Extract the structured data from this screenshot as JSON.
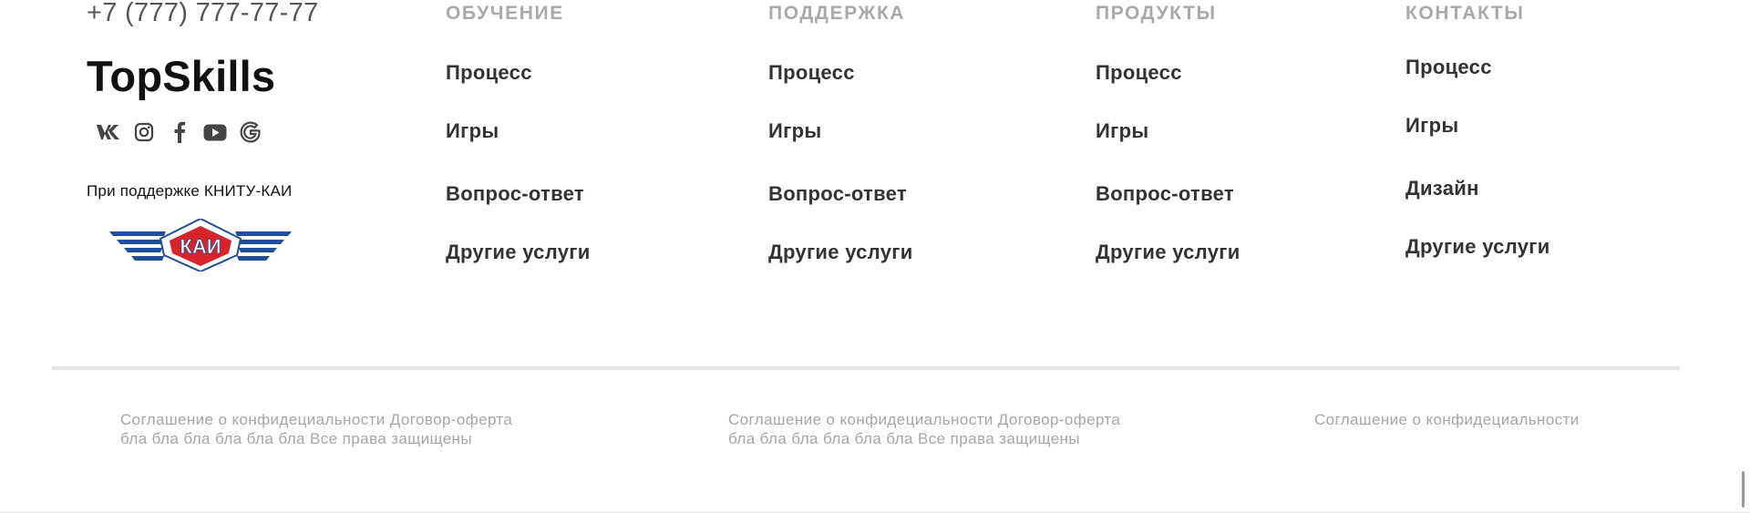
{
  "contact": {
    "phone": "+7 (777) 777-77-77"
  },
  "brand": {
    "name": "TopSkills"
  },
  "socials": [
    {
      "icon": "vk-icon"
    },
    {
      "icon": "instagram-icon"
    },
    {
      "icon": "facebook-icon"
    },
    {
      "icon": "youtube-icon"
    },
    {
      "icon": "google-icon"
    }
  ],
  "support": {
    "text": "При поддержке КНИТУ-КАИ",
    "logo_text": "КАИ"
  },
  "nav": {
    "columns": [
      {
        "heading": "ОБУЧЕНИЕ",
        "links": [
          "Процесс",
          "Игры",
          "Вопрос-ответ",
          "Другие услуги"
        ]
      },
      {
        "heading": "ПОДДЕРЖКА",
        "links": [
          "Процесс",
          "Игры",
          "Вопрос-ответ",
          "Другие услуги"
        ]
      },
      {
        "heading": "ПРОДУКТЫ",
        "links": [
          "Процесс",
          "Игры",
          "Вопрос-ответ",
          "Другие услуги"
        ]
      },
      {
        "heading": "КОНТАКТЫ",
        "links": [
          "Процесс",
          "Игры",
          "Дизайн",
          "Другие услуги"
        ]
      }
    ]
  },
  "legal": [
    {
      "line1": "Соглашение о конфидециальности Договор-оферта",
      "line2": "бла бла бла бла бла бла Все права защищены"
    },
    {
      "line1": "Соглашение о конфидециальности Договор-оферта",
      "line2": "бла бла бла бла бла бла Все права защищены"
    },
    {
      "line1": "Соглашение о конфидециальности"
    }
  ],
  "colors": {
    "heading": "#a9a9a9",
    "link": "#333333",
    "legal": "#a6a6a6",
    "kai_blue": "#1f4e9c",
    "kai_red": "#d6242a"
  }
}
